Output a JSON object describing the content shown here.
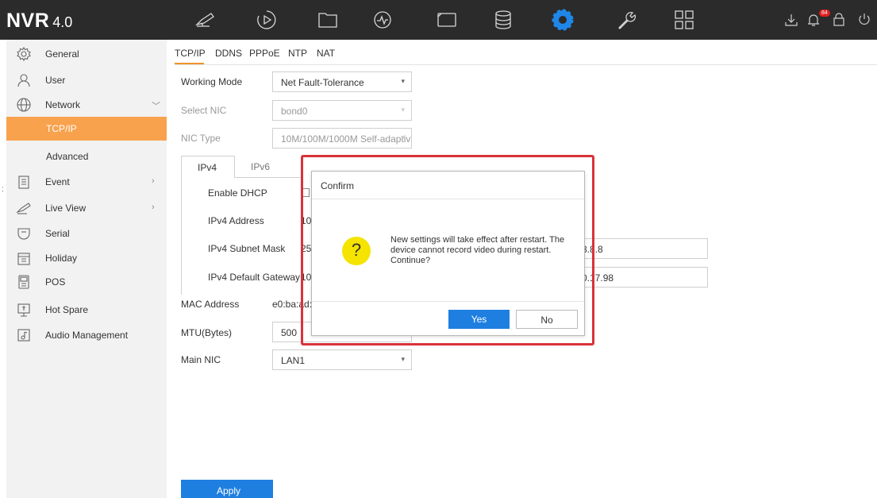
{
  "app": {
    "name": "NVR",
    "version": "4.0"
  },
  "topbar": {
    "icons": [
      "live-view-icon",
      "playback-icon",
      "file-management-icon",
      "smart-analysis-icon",
      "camera-icon",
      "storage-icon",
      "configuration-icon",
      "maintenance-icon",
      "all-menus-icon"
    ],
    "right_icons": [
      "download-icon",
      "alarm-bell-icon",
      "lock-icon"
    ],
    "alarm_count": "84",
    "active_color": "#1f87e8"
  },
  "sidebar": {
    "items": [
      {
        "label": "General",
        "icon": "gear-icon"
      },
      {
        "label": "User",
        "icon": "user-icon"
      },
      {
        "label": "Network",
        "icon": "globe-icon",
        "chevron": "﹀"
      },
      {
        "label": "TCP/IP",
        "active": true
      },
      {
        "label": "Advanced"
      },
      {
        "label": "Event",
        "icon": "clipboard-icon",
        "chevron": "›"
      },
      {
        "label": "Live View",
        "icon": "camera-icon",
        "chevron": "›"
      },
      {
        "label": "Serial",
        "icon": "serial-port-icon"
      },
      {
        "label": "Holiday",
        "icon": "calendar-icon"
      },
      {
        "label": "POS",
        "icon": "pos-terminal-icon"
      },
      {
        "label": "Hot Spare",
        "icon": "hot-spare-icon"
      },
      {
        "label": "Audio Management",
        "icon": "audio-file-icon"
      }
    ],
    "active_color": "#f8a24e"
  },
  "main": {
    "tabs": [
      "TCP/IP",
      "DDNS",
      "PPPoE",
      "NTP",
      "NAT"
    ],
    "working_mode": {
      "label": "Working Mode",
      "value": "Net Fault-Tolerance"
    },
    "select_nic": {
      "label": "Select NIC",
      "value": "bond0"
    },
    "nic_type": {
      "label": "NIC Type",
      "value": "10M/100M/1000M Self-adaptiv"
    },
    "ip_tabs": [
      "IPv4",
      "IPv6"
    ],
    "enable_dhcp": {
      "label": "Enable DHCP"
    },
    "ipv4_address": {
      "label": "IPv4 Address",
      "value": "10"
    },
    "ipv4_subnet_mask": {
      "label": "IPv4 Subnet Mask",
      "value": "25"
    },
    "ipv4_default_gateway": {
      "label": "IPv4 Default Gateway",
      "value": "10"
    },
    "dns1_partial": "8.8.8",
    "dns2_partial": "0.17.98",
    "mac_address": {
      "label": "MAC Address",
      "value": "e0:ba:ad:f"
    },
    "mtu": {
      "label": "MTU(Bytes)",
      "value": "500"
    },
    "main_nic": {
      "label": "Main NIC",
      "value": "LAN1"
    },
    "apply_label": "Apply"
  },
  "dialog": {
    "title": "Confirm",
    "message_lines": [
      "New settings will take effect after restart. The",
      "device cannot record video during restart.",
      "Continue?"
    ],
    "icon_glyph": "?",
    "yes_label": "Yes",
    "no_label": "No"
  },
  "left_marker": ":"
}
